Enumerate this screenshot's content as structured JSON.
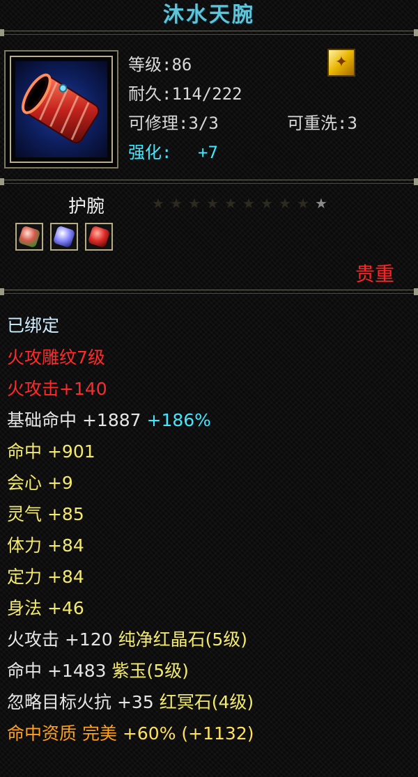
{
  "item": {
    "name": "沐水天腕",
    "level": "等级:86",
    "durability": "耐久:114/222",
    "repairable": "可修理:3/3",
    "rewash": "可重洗:3",
    "enhance_label": "强化:",
    "enhance_value": "+7",
    "type": "护腕",
    "rarity": "贵重",
    "stars_total": 10,
    "stars_lit": 0
  },
  "gems": [
    {
      "icon": "green-gem-icon",
      "color": "#5dbf4a"
    },
    {
      "icon": "purple-gem-icon",
      "color": "#6a6ad8"
    },
    {
      "icon": "red-gem-icon",
      "color": "#d8302a"
    }
  ],
  "attributes": {
    "bound": "已绑定",
    "engrave": "火攻雕纹7级",
    "fire_attack": "火攻击+140",
    "base_hit": {
      "label": "基础命中",
      "value": "+1887",
      "bonus": "+186%"
    },
    "hit": {
      "label": "命中",
      "value": "+901"
    },
    "crit": {
      "label": "会心",
      "value": "+9"
    },
    "spirit": {
      "label": "灵气",
      "value": "+85"
    },
    "stamina": {
      "label": "体力",
      "value": "+84"
    },
    "focus": {
      "label": "定力",
      "value": "+84"
    },
    "agility": {
      "label": "身法",
      "value": "+46"
    },
    "gem_line1": {
      "label": "火攻击",
      "value": "+120",
      "gem": "纯净红晶石(5级)"
    },
    "gem_line2": {
      "label": "命中",
      "value": "+1483",
      "gem": "紫玉(5级)"
    },
    "gem_line3": {
      "label": "忽略目标火抗",
      "value": "+35",
      "gem": "红冥石(4级)"
    },
    "quality": {
      "label": "命中资质",
      "grade": "完美",
      "percent": "+60%",
      "bonus": "(+1132)"
    }
  },
  "colors": {
    "title": "#5ec4da",
    "rarity": "#ff2424",
    "highlight_cyan": "#3fe8ff",
    "gem_text": "#f4ea6b",
    "quality_orange": "#ffa11c"
  }
}
